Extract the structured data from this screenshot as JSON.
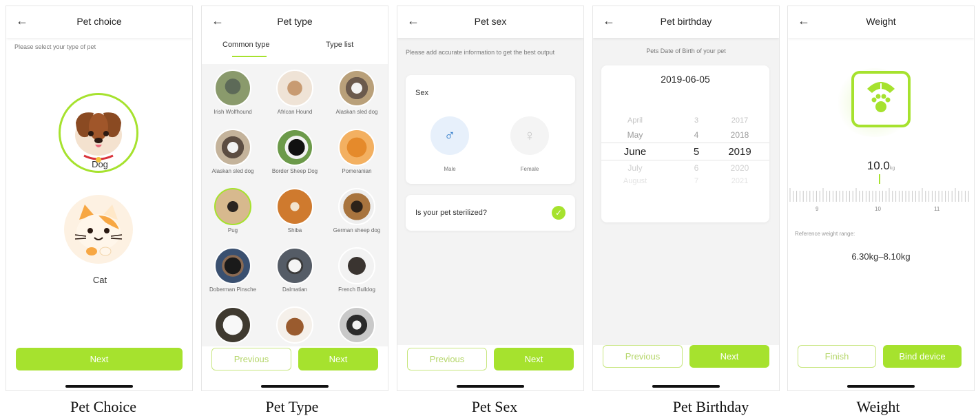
{
  "screens": {
    "pet_choice": {
      "title": "Pet choice",
      "hint": "Please select your type of pet",
      "options": [
        {
          "label": "Dog"
        },
        {
          "label": "Cat"
        }
      ],
      "next": "Next",
      "caption": "Pet Choice"
    },
    "pet_type": {
      "title": "Pet type",
      "tabs": [
        "Common type",
        "Type list"
      ],
      "breeds": [
        "Irish Wolfhound",
        "African Hound",
        "Alaskan sled dog",
        "Alaskan sled dog",
        "Border Sheep Dog",
        "Pomeranian",
        "Pug",
        "Shiba",
        "German sheep dog",
        "Doberman Pinsche",
        "Dalmatian",
        "French Bulldog",
        "",
        "",
        ""
      ],
      "previous": "Previous",
      "next": "Next",
      "caption": "Pet Type"
    },
    "pet_sex": {
      "title": "Pet sex",
      "hint": "Please add accurate information to get the best output",
      "sex_label": "Sex",
      "male": "Male",
      "female": "Female",
      "male_icon": "male-symbol-icon",
      "female_icon": "female-symbol-icon",
      "sterilized_question": "Is your pet sterilized?",
      "sterilized": true,
      "previous": "Previous",
      "next": "Next",
      "caption": "Pet Sex"
    },
    "pet_birthday": {
      "title": "Pet birthday",
      "hint": "Pets Date of Birth of your pet",
      "selected_date": "2019-06-05",
      "wheel": [
        {
          "month": "April",
          "day": "3",
          "year": "2017"
        },
        {
          "month": "May",
          "day": "4",
          "year": "2018"
        },
        {
          "month": "June",
          "day": "5",
          "year": "2019"
        },
        {
          "month": "July",
          "day": "6",
          "year": "2020"
        },
        {
          "month": "August",
          "day": "7",
          "year": "2021"
        }
      ],
      "previous": "Previous",
      "next": "Next",
      "caption": "Pet Birthday"
    },
    "weight": {
      "title": "Weight",
      "value": "10.0",
      "unit": "kg",
      "ruler_labels": [
        "9",
        "10",
        "11"
      ],
      "reference_label": "Reference weight range:",
      "reference_range": "6.30kg–8.10kg",
      "finish": "Finish",
      "bind_device": "Bind device",
      "caption": "Weight"
    }
  },
  "colors": {
    "accent": "#a6e22e",
    "accent_border": "#c7e67e",
    "background_gray": "#f3f3f3"
  }
}
